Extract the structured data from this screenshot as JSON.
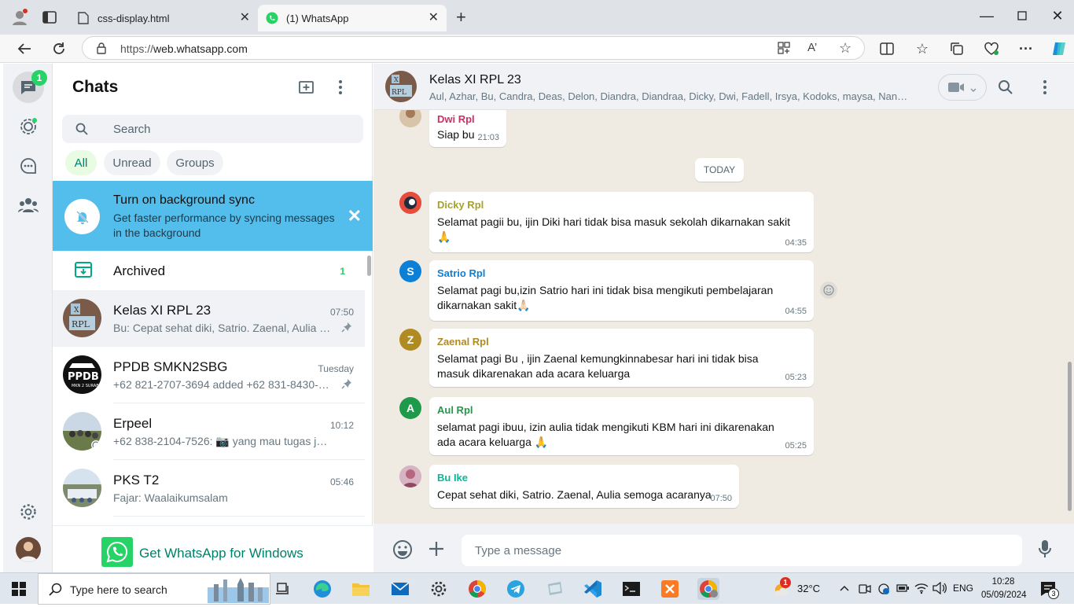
{
  "browser": {
    "tabs": [
      {
        "label": "css-display.html"
      },
      {
        "label": "(1) WhatsApp"
      }
    ],
    "url_scheme": "https://",
    "url_host": "web.whatsapp.com"
  },
  "rail": {
    "chats_badge": "1"
  },
  "chat_list": {
    "title": "Chats",
    "search_placeholder": "Search",
    "filters": [
      "All",
      "Unread",
      "Groups"
    ],
    "sync_banner": {
      "title": "Turn on background sync",
      "body": "Get faster performance by syncing messages in the background"
    },
    "archived": {
      "label": "Archived",
      "count": "1"
    },
    "chats": [
      {
        "name": "Kelas XI RPL 23",
        "time": "07:50",
        "preview": "Bu: Cepat sehat diki, Satrio. Zaenal, Aulia se...",
        "pinned": true
      },
      {
        "name": "PPDB SMKN2SBG",
        "time": "Tuesday",
        "preview": "+62 821-2707-3694 added +62 831-8430-1...",
        "pinned": true
      },
      {
        "name": "Erpeel",
        "time": "10:12",
        "preview": "+62 838-2104-7526: 📷 yang mau tugas jepan...",
        "pinned": false
      },
      {
        "name": "PKS T2",
        "time": "05:46",
        "preview": "Fajar: Waalaikumsalam",
        "pinned": false
      }
    ],
    "get_app": "Get WhatsApp for Windows"
  },
  "conversation": {
    "group_name": "Kelas XI RPL 23",
    "members": "Aul, Azhar, Bu, Candra, Deas, Delon, Diandra, Diandraa, Dicky, Dwi, Fadell, Irsya, Kodoks, maysa, Nanda, Ni...",
    "date_divider": "TODAY",
    "messages": [
      {
        "sender": "Dwi Rpl",
        "text": "Siap bu",
        "time": "21:03",
        "color": "#d42a66"
      },
      {
        "sender": "Dicky Rpl",
        "text": "Selamat pagii bu, ijin Diki hari tidak bisa masuk sekolah dikarnakan  sakit 🙏",
        "time": "04:35",
        "color": "#a5a032"
      },
      {
        "sender": "Satrio Rpl",
        "text": "Selamat pagi bu,izin Satrio hari ini tidak bisa mengikuti pembelajaran dikarnakan sakit🙏🏻",
        "time": "04:55",
        "color": "#0c7fd6",
        "initial": "S"
      },
      {
        "sender": "Zaenal Rpl",
        "text": "Selamat pagi Bu , ijin Zaenal kemungkinnabesar hari ini tidak bisa masuk dikarenakan ada acara keluarga",
        "time": "05:23",
        "color": "#b08b21",
        "initial": "Z"
      },
      {
        "sender": "Aul Rpl",
        "text": "selamat pagi ibuu, izin aulia tidak mengikuti KBM hari ini dikarenakan ada acara keluarga 🙏",
        "time": "05:25",
        "color": "#1f9a4a",
        "initial": "A"
      },
      {
        "sender": "Bu Ike",
        "text": "Cepat sehat diki, Satrio. Zaenal, Aulia semoga acaranya",
        "time": "07:50",
        "color": "#06b899"
      }
    ],
    "input_placeholder": "Type a message"
  },
  "taskbar": {
    "search_placeholder": "Type here to search",
    "weather": "32°C",
    "language": "ENG",
    "time": "10:28",
    "date": "05/09/2024",
    "notification_count": "3",
    "weather_alert": "1"
  }
}
